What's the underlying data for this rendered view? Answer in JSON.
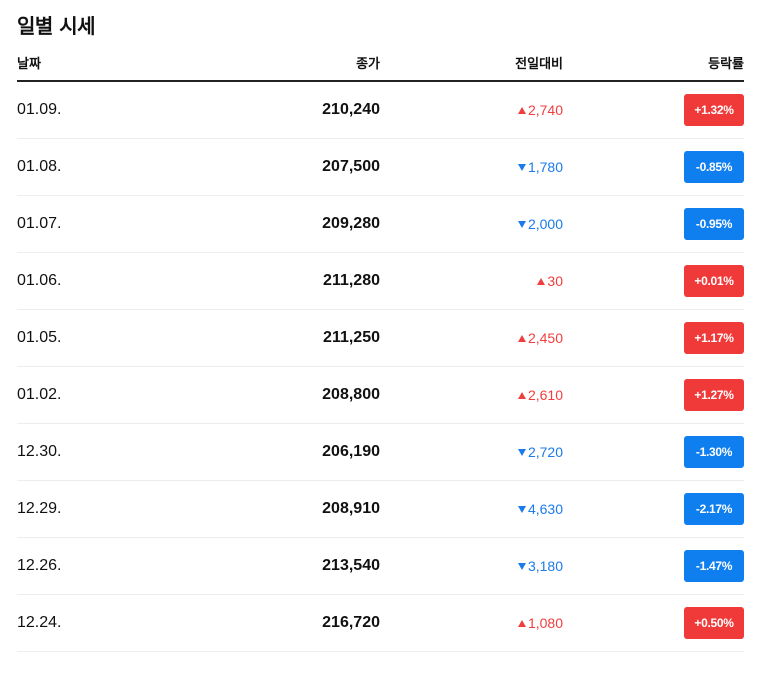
{
  "title": "일별 시세",
  "headers": {
    "date": "날짜",
    "close": "종가",
    "change": "전일대비",
    "rate": "등락률"
  },
  "colors": {
    "up": "#f03e3e",
    "down": "#1b7be8",
    "badge_up": "#f03a3a",
    "badge_down": "#0f7ff0"
  },
  "rows": [
    {
      "date": "01.09.",
      "close": "210,240",
      "change": "2,740",
      "direction": "up",
      "rate": "+1.32%"
    },
    {
      "date": "01.08.",
      "close": "207,500",
      "change": "1,780",
      "direction": "down",
      "rate": "-0.85%"
    },
    {
      "date": "01.07.",
      "close": "209,280",
      "change": "2,000",
      "direction": "down",
      "rate": "-0.95%"
    },
    {
      "date": "01.06.",
      "close": "211,280",
      "change": "30",
      "direction": "up",
      "rate": "+0.01%"
    },
    {
      "date": "01.05.",
      "close": "211,250",
      "change": "2,450",
      "direction": "up",
      "rate": "+1.17%"
    },
    {
      "date": "01.02.",
      "close": "208,800",
      "change": "2,610",
      "direction": "up",
      "rate": "+1.27%"
    },
    {
      "date": "12.30.",
      "close": "206,190",
      "change": "2,720",
      "direction": "down",
      "rate": "-1.30%"
    },
    {
      "date": "12.29.",
      "close": "208,910",
      "change": "4,630",
      "direction": "down",
      "rate": "-2.17%"
    },
    {
      "date": "12.26.",
      "close": "213,540",
      "change": "3,180",
      "direction": "down",
      "rate": "-1.47%"
    },
    {
      "date": "12.24.",
      "close": "216,720",
      "change": "1,080",
      "direction": "up",
      "rate": "+0.50%"
    }
  ]
}
